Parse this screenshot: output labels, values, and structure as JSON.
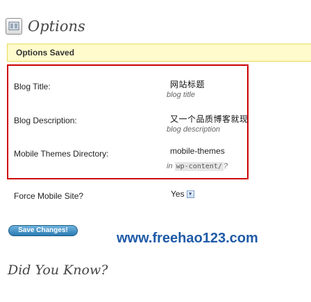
{
  "header": {
    "icon": "settings-page-icon",
    "title": "Options"
  },
  "notice": {
    "text": "Options Saved"
  },
  "fields": {
    "blog_title": {
      "label": "Blog Title:",
      "value": "网站标题",
      "hint": "blog title"
    },
    "blog_description": {
      "label": "Blog Description:",
      "value": "又一个品质博客就现",
      "hint": "blog description"
    },
    "themes_directory": {
      "label": "Mobile Themes Directory:",
      "value": "mobile-themes",
      "hint_prefix": "in",
      "hint_code": "wp-content/",
      "hint_suffix": "?"
    },
    "force_mobile": {
      "label": "Force Mobile Site?",
      "value": "Yes"
    }
  },
  "actions": {
    "save_label": "Save Changes!"
  },
  "watermark": "www.freehao123.com",
  "section": {
    "did_you_know": "Did You Know?"
  },
  "colors": {
    "accent_border": "#cc0000",
    "notice_bg": "#fffbcc",
    "button": "#2b7bb3"
  }
}
